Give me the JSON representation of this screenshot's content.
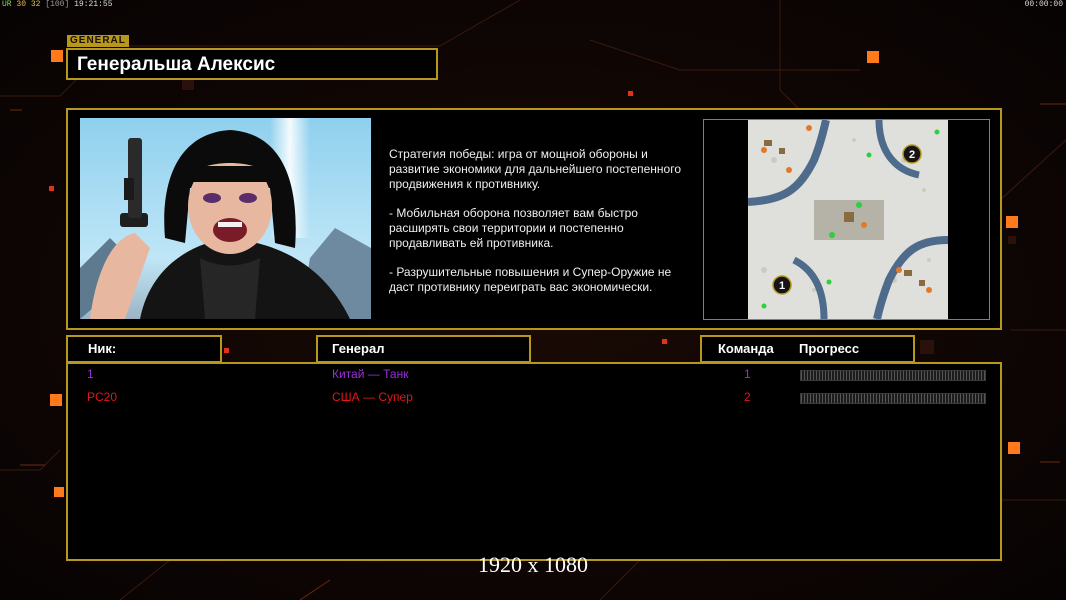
{
  "hud": {
    "stat1": "UR",
    "stat2": "30",
    "stat3": "32",
    "stat4": "[100]",
    "clock": "19:21:55",
    "timer": "00:00:00"
  },
  "general": {
    "tag": "GENERAL",
    "name": "Генеральша Алексис"
  },
  "strategy": {
    "paragraphs": [
      "Стратегия победы: игра от мощной обороны и развитие экономики для дальнейшего постепенного продвижения к противнику.",
      "- Мобильная оборона позволяет вам быстро расширять свои территории и постепенно продавливать ей противника.",
      "- Разрушительные повышения и Супер-Оружие не даст противнику переиграть вас экономически."
    ]
  },
  "map": {
    "slot1": "1",
    "slot2": "2"
  },
  "table": {
    "headers": {
      "nick": "Ник:",
      "general": "Генерал",
      "team": "Команда",
      "progress": "Прогресс"
    },
    "players": [
      {
        "nick": "1",
        "general": "Китай — Танк",
        "team": "1",
        "color": "#9a2fd9"
      },
      {
        "nick": "PC20",
        "general": "США — Супер",
        "team": "2",
        "color": "#e01818"
      }
    ]
  },
  "watermark": "1920 x 1080",
  "colors": {
    "frame": "#b8981c",
    "accent": "#ff7a1a"
  }
}
